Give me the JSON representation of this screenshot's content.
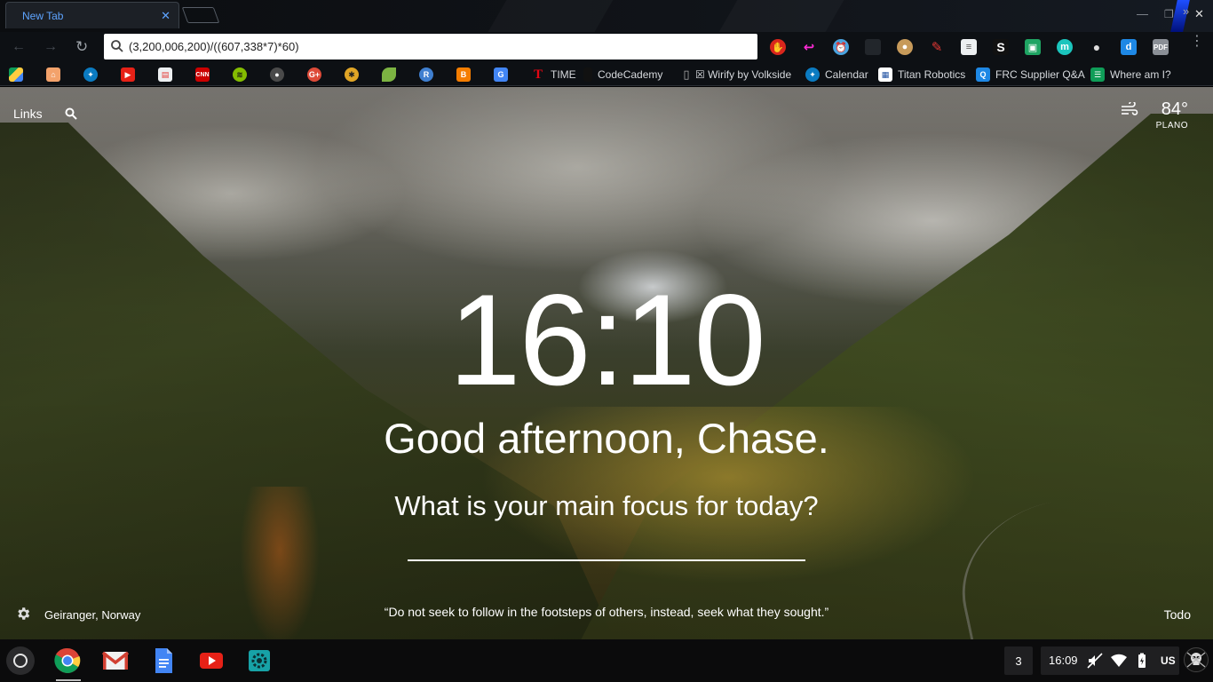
{
  "browser": {
    "tab_title": "New Tab",
    "omnibox_value": "(3,200,006,200)/((607,338*7)*60)",
    "extension_icons": [
      "ublock-icon",
      "pocket-icon",
      "alarm-clock-icon",
      "dark-extension-icon",
      "palette-icon",
      "marker-icon",
      "document-icon",
      "s-icon",
      "classroom-icon",
      "momentum-m-icon",
      "balloon-icon",
      "d-icon",
      "pdf-icon"
    ],
    "bookmarks": [
      {
        "icon": "google-drive-icon",
        "label": ""
      },
      {
        "icon": "bookmark-app-icon",
        "label": ""
      },
      {
        "icon": "spartan-icon",
        "label": ""
      },
      {
        "icon": "youtube-icon",
        "label": ""
      },
      {
        "icon": "store-icon",
        "label": ""
      },
      {
        "icon": "cnn-icon",
        "label": ""
      },
      {
        "icon": "spotify-icon",
        "label": ""
      },
      {
        "icon": "github-icon",
        "label": ""
      },
      {
        "icon": "google-plus-icon",
        "label": ""
      },
      {
        "icon": "wolf-icon",
        "label": ""
      },
      {
        "icon": "leaf-icon",
        "label": ""
      },
      {
        "icon": "robot-icon",
        "label": ""
      },
      {
        "icon": "blogger-icon",
        "label": ""
      },
      {
        "icon": "translate-icon",
        "label": ""
      },
      {
        "icon": "time-icon",
        "label": "TIME"
      },
      {
        "icon": "codecademy-icon",
        "label": "CodeCademy"
      },
      {
        "icon": "page-icon",
        "label": "☒ Wirify by Volkside"
      },
      {
        "icon": "calendar-icon",
        "label": "Calendar"
      },
      {
        "icon": "titan-robotics-icon",
        "label": "Titan Robotics"
      },
      {
        "icon": "frc-icon",
        "label": "FRC Supplier Q&A"
      },
      {
        "icon": "where-am-i-icon",
        "label": "Where am I?"
      }
    ]
  },
  "momentum": {
    "links_label": "Links",
    "weather_temp": "84°",
    "weather_location": "PLANO",
    "clock": "16:10",
    "greeting": "Good afternoon, Chase.",
    "focus_question": "What is your main focus for today?",
    "focus_value": "",
    "photo_location": "Geiranger, Norway",
    "quote": "“Do not seek to follow in the footsteps of others, instead, seek what they sought.”",
    "todo_label": "Todo"
  },
  "shelf": {
    "apps": [
      "chrome-icon",
      "gmail-icon",
      "docs-icon",
      "youtube-icon",
      "settings-icon"
    ],
    "notification_count": "3",
    "time": "16:09",
    "input_method": "US"
  },
  "colors": {
    "tab_text": "#5ea4ff",
    "toolbar_bg": "#0d1014",
    "shelf_bg": "#0b0b0c"
  }
}
